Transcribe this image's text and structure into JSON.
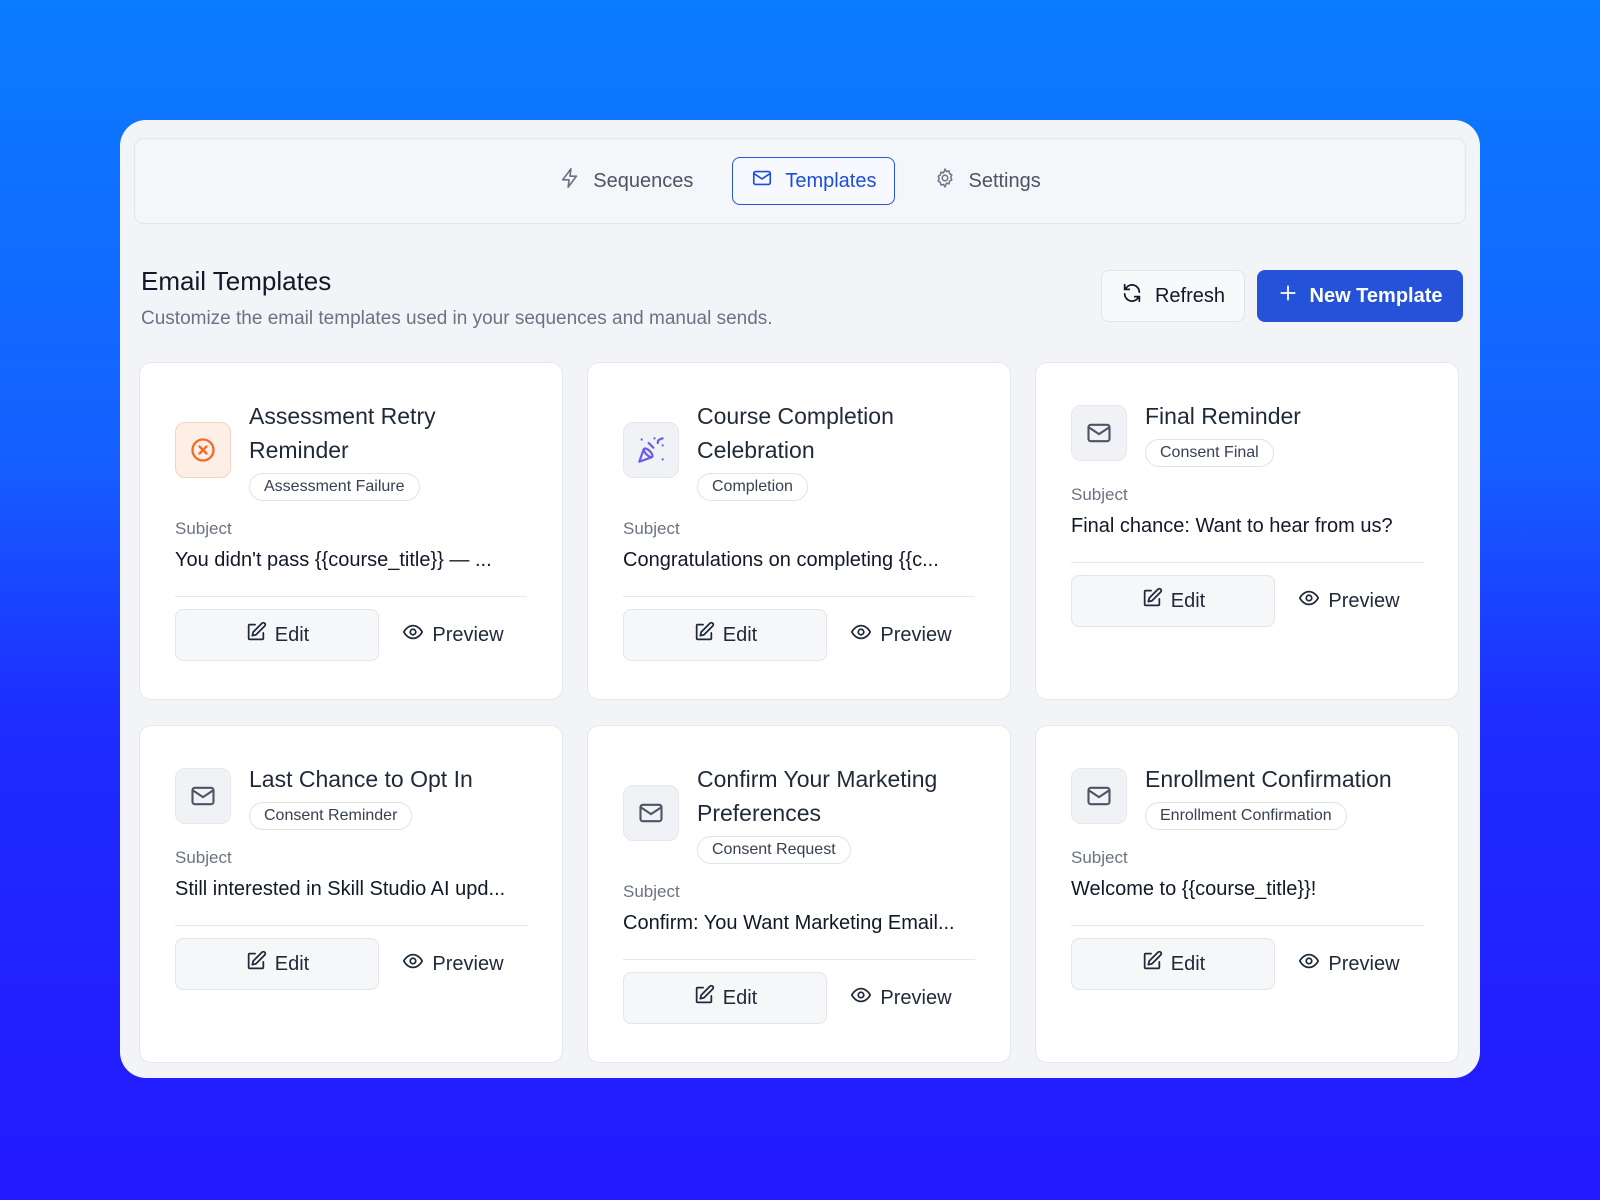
{
  "nav": {
    "tabs": [
      {
        "label": "Sequences",
        "icon": "lightning-icon"
      },
      {
        "label": "Templates",
        "icon": "mail-icon",
        "active": true
      },
      {
        "label": "Settings",
        "icon": "gear-icon"
      }
    ]
  },
  "header": {
    "title": "Email Templates",
    "subtitle": "Customize the email templates used in your sequences and manual sends.",
    "refresh_label": "Refresh",
    "new_label": "New Template"
  },
  "colors": {
    "primary": "#2452d8",
    "accent_orange": "#f26b2a",
    "accent_purple": "#6d5ce8"
  },
  "subject_label": "Subject",
  "edit_label": "Edit",
  "preview_label": "Preview",
  "templates": [
    {
      "title": "Assessment Retry Reminder",
      "badge": "Assessment Failure",
      "subject": "You didn't pass {{course_title}} — ...",
      "icon": "x-circle-icon"
    },
    {
      "title": "Course Completion Celebration",
      "badge": "Completion",
      "subject": "Congratulations on completing {{c...",
      "icon": "party-popper-icon"
    },
    {
      "title": "Final Reminder",
      "badge": "Consent Final",
      "subject": "Final chance: Want to hear from us?",
      "icon": "mail-icon"
    },
    {
      "title": "Last Chance to Opt In",
      "badge": "Consent Reminder",
      "subject": "Still interested in Skill Studio AI upd...",
      "icon": "mail-icon"
    },
    {
      "title": "Confirm Your Marketing Preferences",
      "badge": "Consent Request",
      "subject": "Confirm: You Want Marketing Email...",
      "icon": "mail-icon"
    },
    {
      "title": "Enrollment Confirmation",
      "badge": "Enrollment Confirmation",
      "subject": "Welcome to {{course_title}}!",
      "icon": "mail-icon"
    }
  ]
}
